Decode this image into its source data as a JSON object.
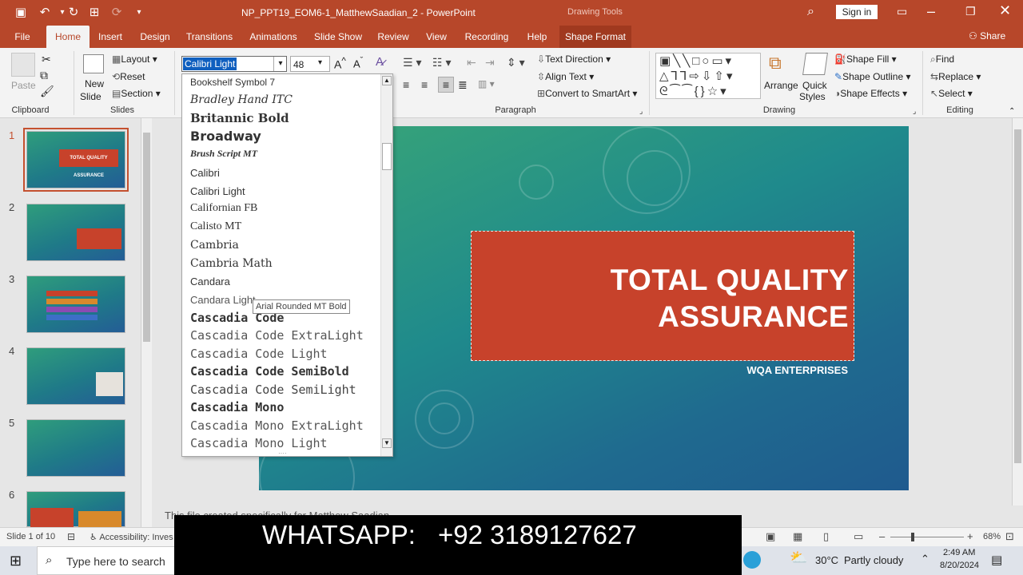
{
  "title_bar": {
    "doc_title": "NP_PPT19_EOM6-1_MatthewSaadian_2 - PowerPoint",
    "context_title": "Drawing Tools",
    "sign_in": "Sign in"
  },
  "tabs": [
    "File",
    "Home",
    "Insert",
    "Design",
    "Transitions",
    "Animations",
    "Slide Show",
    "Review",
    "View",
    "Recording",
    "Help",
    "Shape Format"
  ],
  "share_label": "Share",
  "clipboard": {
    "paste": "Paste",
    "group": "Clipboard"
  },
  "slides_group": {
    "new_slide_1": "New",
    "new_slide_2": "Slide",
    "layout": "Layout",
    "reset": "Reset",
    "section": "Section",
    "group": "Slides"
  },
  "font": {
    "name": "Calibri Light",
    "size": "48"
  },
  "paragraph": {
    "text_direction": "Text Direction",
    "align_text": "Align Text",
    "smartart": "Convert to SmartArt",
    "group": "Paragraph"
  },
  "drawing": {
    "arrange": "Arrange",
    "quick_styles_1": "Quick",
    "quick_styles_2": "Styles",
    "shape_fill": "Shape Fill",
    "shape_outline": "Shape Outline",
    "shape_effects": "Shape Effects",
    "group": "Drawing"
  },
  "editing": {
    "find": "Find",
    "replace": "Replace",
    "select": "Select",
    "group": "Editing"
  },
  "font_list": [
    "Bookshelf Symbol 7",
    "Bradley Hand ITC",
    "Britannic Bold",
    "Broadway",
    "Brush Script MT",
    "Calibri",
    "Calibri Light",
    "Californian FB",
    "Calisto MT",
    "Cambria",
    "Cambria Math",
    "Candara",
    "Candara Light",
    "Cascadia Code",
    "Cascadia Code ExtraLight",
    "Cascadia Code Light",
    "Cascadia Code SemiBold",
    "Cascadia Code SemiLight",
    "Cascadia Mono",
    "Cascadia Mono ExtraLight",
    "Cascadia Mono Light"
  ],
  "tooltip": "Arial Rounded MT Bold",
  "slide": {
    "title_line1": "TOTAL QUALITY",
    "title_line2": "ASSURANCE",
    "subtitle": "WQA ENTERPRISES"
  },
  "thumbnails": [
    "1",
    "2",
    "3",
    "4",
    "5",
    "6"
  ],
  "thumb1_title": "TOTAL QUALITY ASSURANCE",
  "notes_text": "This file created specifically for Matthew Saadian",
  "status": {
    "slide_count": "Slide 1 of 10",
    "accessibility": "Accessibility: Inves",
    "zoom": "68%"
  },
  "overlay": {
    "label": "WHATSAPP:",
    "number": "+92 3189127627"
  },
  "taskbar": {
    "search": "Type here to search",
    "temp": "30°C",
    "weather": "Partly cloudy",
    "time": "2:49 AM",
    "date": "8/20/2024"
  },
  "colors": {
    "brand": "#b7472a",
    "slide_red": "#c7422b"
  }
}
